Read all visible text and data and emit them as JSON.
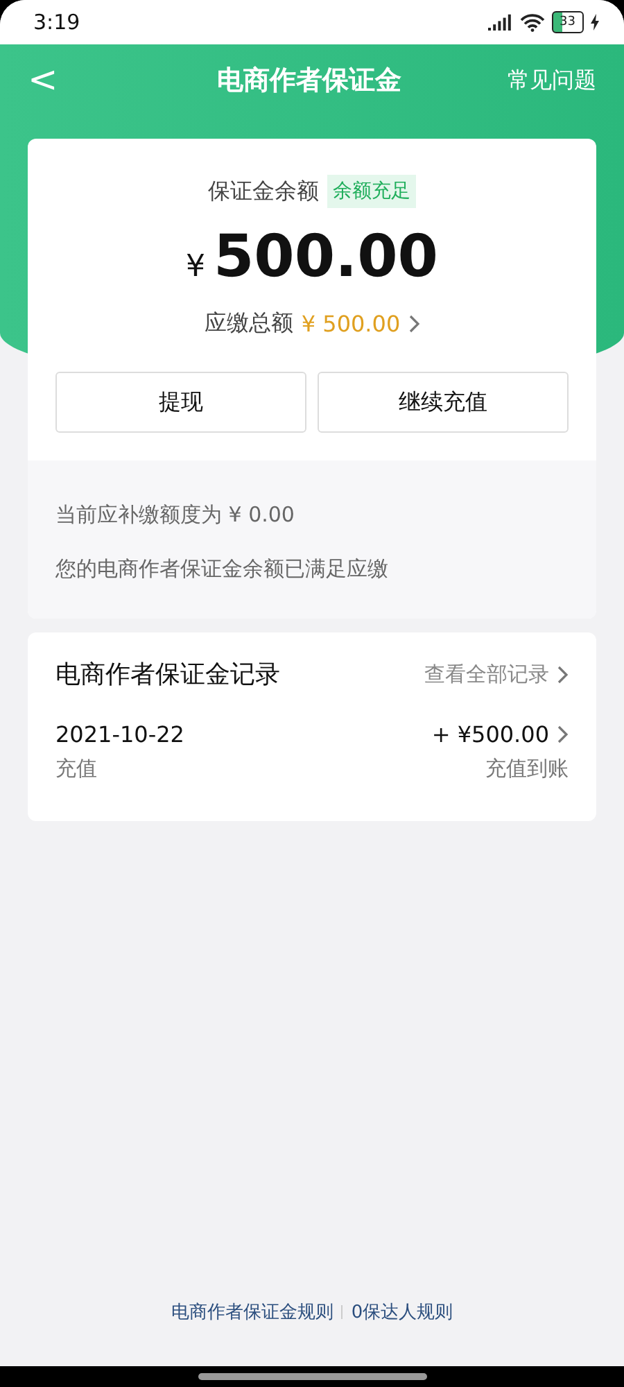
{
  "status_bar": {
    "time": "3:19",
    "battery": "33"
  },
  "nav": {
    "back": "<",
    "title": "电商作者保证金",
    "action": "常见问题"
  },
  "balance": {
    "label": "保证金余额",
    "badge": "余额充足",
    "currency": "¥",
    "amount": "500.00",
    "due_label": "应缴总额",
    "due_amount": "¥ 500.00"
  },
  "buttons": [
    {
      "label": "提现"
    },
    {
      "label": "继续充值"
    }
  ],
  "notice": {
    "line_1": "当前应补缴额度为 ¥ 0.00",
    "line_2": "您的电商作者保证金余额已满足应缴"
  },
  "records": {
    "title": "电商作者保证金记录",
    "view_all": "查看全部记录",
    "items": [
      {
        "date": "2021-10-22",
        "type": "充值",
        "amount": "+ ¥500.00",
        "status": "充值到账"
      }
    ]
  },
  "footer_links": [
    {
      "label": "电商作者保证金规则"
    },
    {
      "label": "0保达人规则"
    }
  ]
}
